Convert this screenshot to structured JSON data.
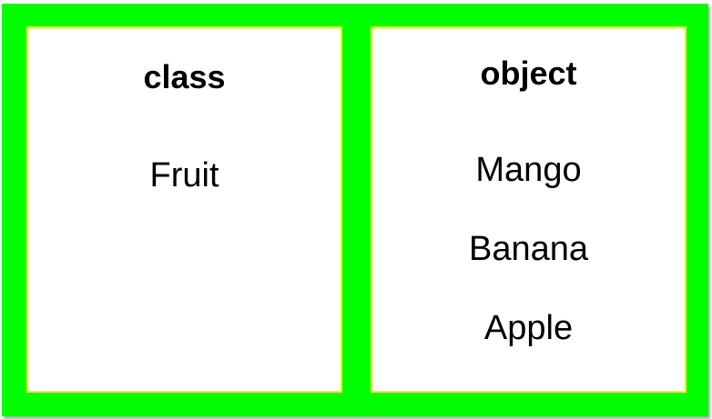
{
  "colors": {
    "frame": "#00ff00",
    "panel_border": "#f2f200",
    "panel_background": "#ffffff",
    "text": "#000000"
  },
  "class_panel": {
    "heading": "class",
    "items": [
      "Fruit"
    ]
  },
  "object_panel": {
    "heading": "object",
    "items": [
      "Mango",
      "Banana",
      "Apple"
    ]
  }
}
